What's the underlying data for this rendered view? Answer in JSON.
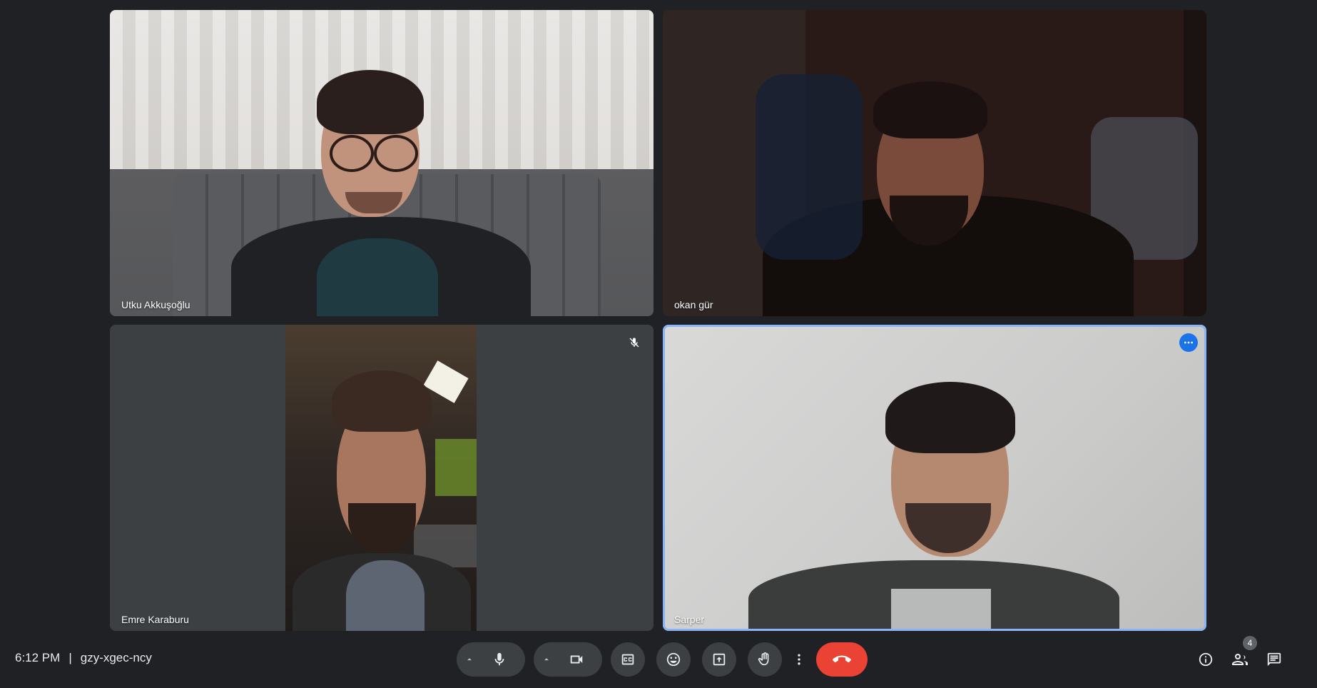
{
  "participants": [
    {
      "name": "Utku Akkuşoğlu"
    },
    {
      "name": "okan gür"
    },
    {
      "name": "Emre Karaburu",
      "muted": true
    },
    {
      "name": "Sarper",
      "active_speaker": true
    }
  ],
  "meeting": {
    "time": "6:12 PM",
    "separator": "|",
    "code": "gzy-xgec-ncy"
  },
  "toolbar": {
    "icons": [
      "chevron-up-icon",
      "microphone-icon",
      "chevron-up-icon",
      "camera-icon",
      "captions-icon",
      "emoji-icon",
      "present-screen-icon",
      "raise-hand-icon",
      "more-options-icon",
      "end-call-icon"
    ],
    "end_call_color": "#ea4335"
  },
  "side_panel": {
    "participant_count": "4",
    "icons": [
      "info-icon",
      "people-icon",
      "chat-icon"
    ]
  },
  "colors": {
    "background": "#202124",
    "tile": "#3c4043",
    "accent": "#1a73e8",
    "focus": "#8ab4f8"
  }
}
